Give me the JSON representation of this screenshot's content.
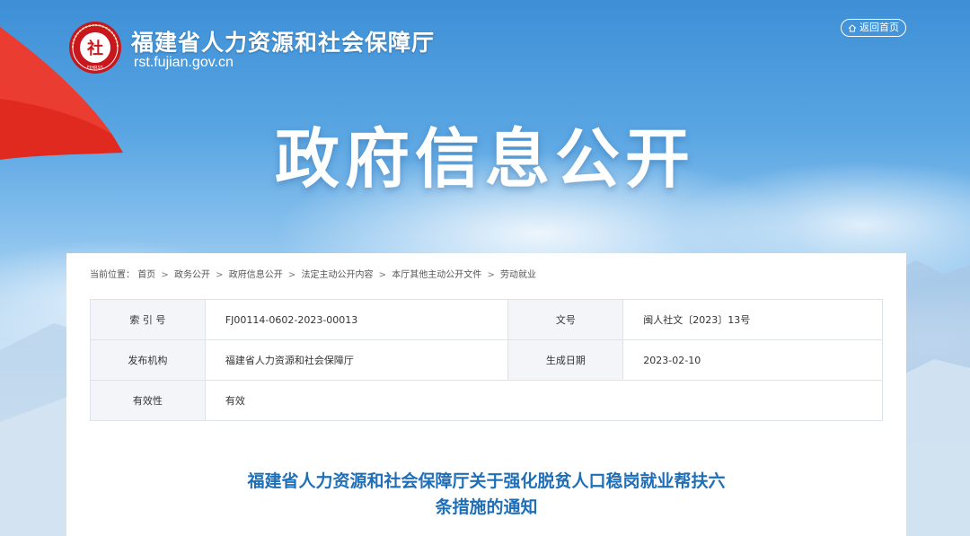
{
  "header": {
    "site_name": "福建省人力资源和社会保障厅",
    "domain": "rst.fujian.gov.cn",
    "back_home_label": "返回首页",
    "logo_char": "社",
    "logo_ring_text": "FJHRSS"
  },
  "banner": {
    "title": "政府信息公开"
  },
  "breadcrumb": {
    "label": "当前位置：",
    "items": [
      "首页",
      "政务公开",
      "政府信息公开",
      "法定主动公开内容",
      "本厅其他主动公开文件",
      "劳动就业"
    ]
  },
  "meta": {
    "index_label": "索 引 号",
    "index_value": "FJ00114-0602-2023-00013",
    "docno_label": "文号",
    "docno_value": "闽人社文〔2023〕13号",
    "issuer_label": "发布机构",
    "issuer_value": "福建省人力资源和社会保障厅",
    "date_label": "生成日期",
    "date_value": "2023-02-10",
    "validity_label": "有效性",
    "validity_value": "有效"
  },
  "document": {
    "title_line1": "福建省人力资源和社会保障厅关于强化脱贫人口稳岗就业帮扶六",
    "title_line2": "条措施的通知"
  },
  "colors": {
    "flag_red": "#e02a1f",
    "title_blue": "#1f6fb8",
    "sky_blue": "#3d8fd6"
  }
}
